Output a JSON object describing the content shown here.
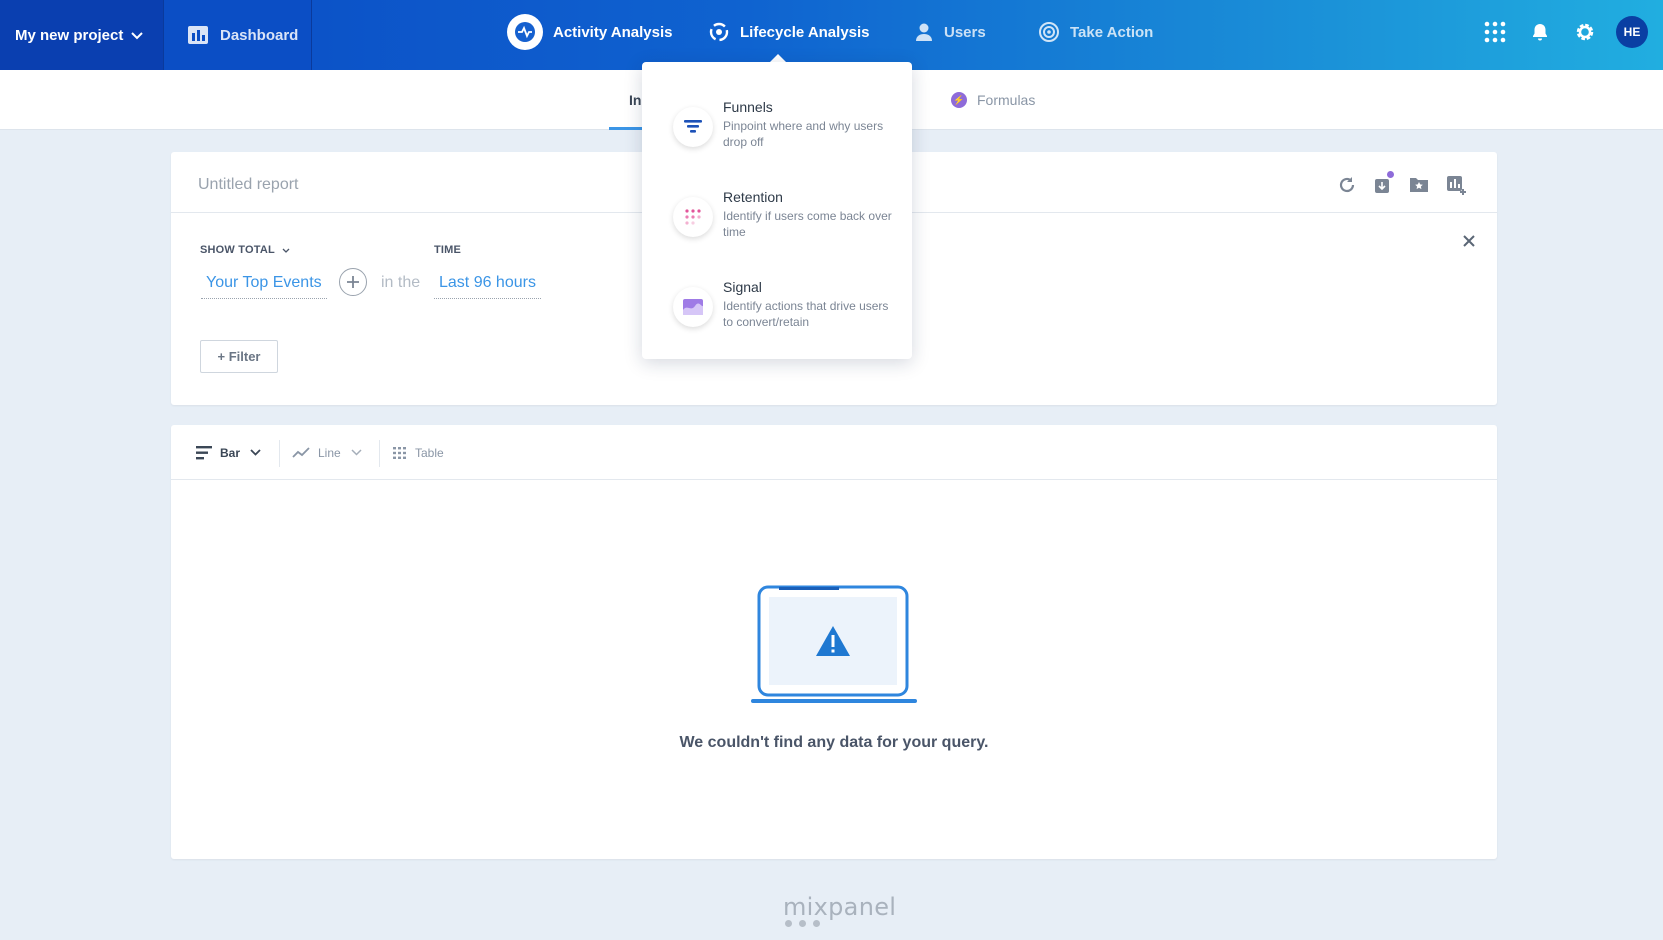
{
  "topnav": {
    "project": "My new project",
    "dashboard": "Dashboard",
    "items": [
      {
        "label": "Activity Analysis",
        "icon": "activity-icon"
      },
      {
        "label": "Lifecycle Analysis",
        "icon": "lifecycle-icon"
      },
      {
        "label": "Users",
        "icon": "user-icon"
      },
      {
        "label": "Take Action",
        "icon": "target-icon"
      }
    ],
    "avatar": "HE"
  },
  "subnav": {
    "tabs": [
      {
        "label": "Ins"
      },
      {
        "label": "Formulas"
      }
    ]
  },
  "report": {
    "title": "Untitled report",
    "show_total": "SHOW TOTAL",
    "time_label": "TIME",
    "events": "Your Top Events",
    "in_the": "in the",
    "time_range": "Last 96 hours",
    "filter": "+ Filter"
  },
  "chart_toolbar": {
    "bar": "Bar",
    "line": "Line",
    "table": "Table"
  },
  "empty_state": {
    "message": "We couldn't find any data for your query."
  },
  "footer": {
    "logo": "mixpanel"
  },
  "dropdown": {
    "items": [
      {
        "title": "Funnels",
        "desc": "Pinpoint where and why users drop off",
        "icon": "funnel-icon"
      },
      {
        "title": "Retention",
        "desc": "Identify if users come back over time",
        "icon": "retention-icon"
      },
      {
        "title": "Signal",
        "desc": "Identify actions that drive users to convert/retain",
        "icon": "signal-icon"
      }
    ]
  },
  "colors": {
    "brand_dark": "#0a3fb0",
    "accent_blue": "#3b95e6",
    "purple": "#8e6bd9"
  }
}
